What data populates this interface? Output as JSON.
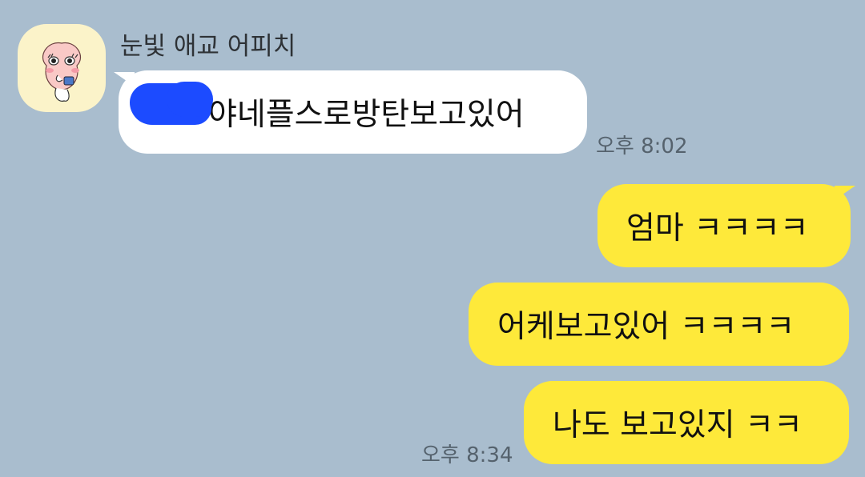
{
  "chat": {
    "sender_name": "눈빛 애교 어피치",
    "avatar_icon": "apeach-sticker-avatar",
    "messages": [
      {
        "direction": "incoming",
        "text": "야네플스로방탄보고있어",
        "redacted_prefix": true,
        "time": "오후 8:02"
      },
      {
        "direction": "outgoing",
        "text": "엄마 ㅋㅋㅋㅋ"
      },
      {
        "direction": "outgoing",
        "text": "어케보고있어 ㅋㅋㅋㅋ"
      },
      {
        "direction": "outgoing",
        "text": "나도 보고있지 ㅋㅋ",
        "time": "오후 8:34"
      }
    ]
  },
  "colors": {
    "background": "#a9bdce",
    "incoming_bubble": "#ffffff",
    "outgoing_bubble": "#fee93a",
    "redaction": "#1c4bff"
  }
}
